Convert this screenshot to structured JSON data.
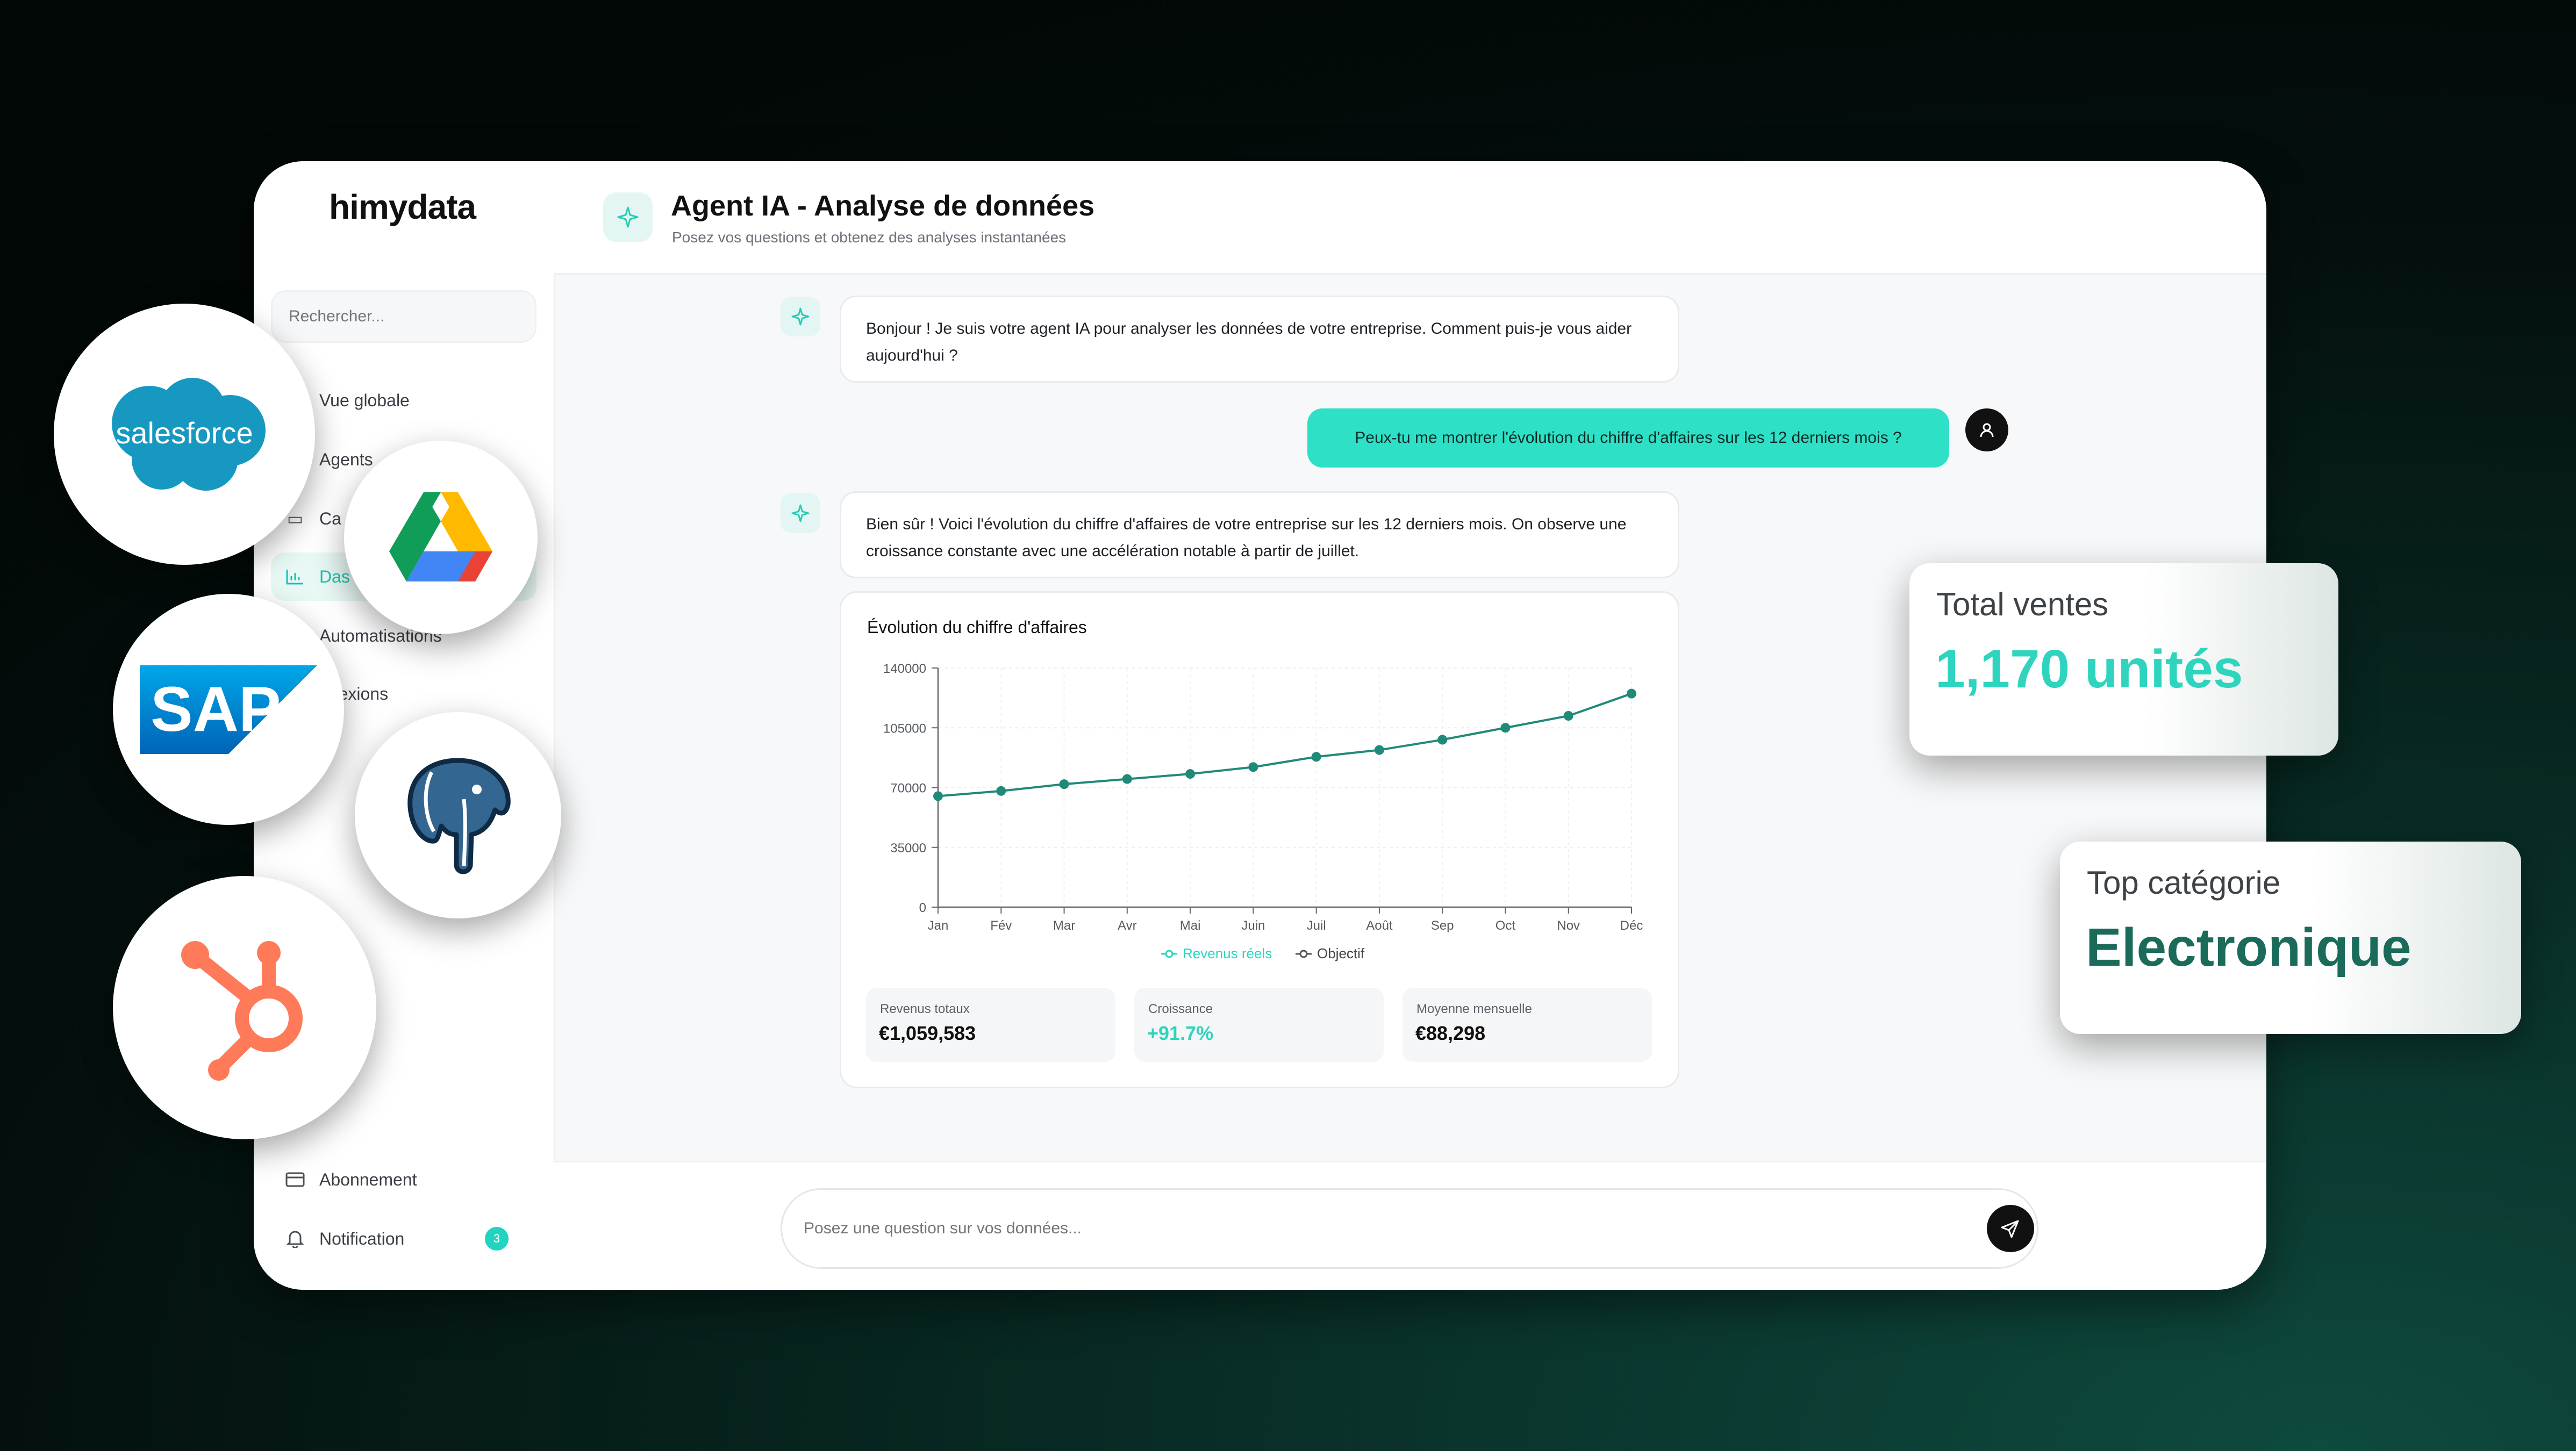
{
  "colors": {
    "accent": "#2ee0c5",
    "accent_text": "#17c3b0",
    "dark_green": "#1b6b5a"
  },
  "sidebar": {
    "logo": "himydata",
    "search_placeholder": "Rechercher...",
    "items": [
      {
        "label": "Vue globale",
        "icon": "grid-icon"
      },
      {
        "label": "Agents",
        "icon": "bot-icon"
      },
      {
        "label": "Ca",
        "icon": "folder-icon"
      },
      {
        "label": "Das",
        "icon": "bar-chart-icon",
        "active": true
      },
      {
        "label": "Automatisations",
        "icon": "zap-icon"
      },
      {
        "label": "nnexions",
        "icon": "link-icon"
      }
    ],
    "bottom": [
      {
        "label": "Abonnement",
        "icon": "card-icon"
      },
      {
        "label": "Notification",
        "icon": "bell-icon",
        "badge": "3"
      }
    ]
  },
  "header": {
    "title": "Agent IA - Analyse de données",
    "subtitle": "Posez vos questions et obtenez des analyses instantanées"
  },
  "chat": {
    "ai_msg_1": "Bonjour ! Je suis votre agent IA pour analyser les données de votre entreprise. Comment puis-je vous aider aujourd'hui ?",
    "user_msg": "Peux-tu me montrer l'évolution du chiffre d'affaires sur les 12 derniers mois ?",
    "ai_msg_2": "Bien sûr ! Voici l'évolution du chiffre d'affaires de votre entreprise sur les 12 derniers mois. On observe une croissance constante avec une accélération notable à partir de juillet."
  },
  "chart_data": {
    "type": "line",
    "title": "Évolution du chiffre d'affaires",
    "categories": [
      "Jan",
      "Fév",
      "Mar",
      "Avr",
      "Mai",
      "Juin",
      "Juil",
      "Août",
      "Sep",
      "Oct",
      "Nov",
      "Déc"
    ],
    "series": [
      {
        "name": "Revenus réels",
        "values": [
          65000,
          68000,
          72000,
          75000,
          78000,
          82000,
          88000,
          92000,
          98000,
          105000,
          112000,
          125000
        ]
      },
      {
        "name": "Objectif",
        "values": []
      }
    ],
    "ylim": [
      0,
      140000
    ],
    "yticks": [
      "0",
      "35000",
      "70000",
      "105000",
      "140000"
    ],
    "grid": true,
    "legend": "bottom"
  },
  "stats": [
    {
      "label": "Revenus totaux",
      "value": "€1,059,583"
    },
    {
      "label": "Croissance",
      "value": "+91.7%"
    },
    {
      "label": "Moyenne mensuelle",
      "value": "€88,298"
    }
  ],
  "input": {
    "placeholder": "Posez une question sur vos données..."
  },
  "cards": {
    "sales_label": "Total ventes",
    "sales_value": "1,170 unités",
    "category_label": "Top catégorie",
    "category_value": "Electronique"
  },
  "integrations": {
    "salesforce": "salesforce",
    "sap": "SAP",
    "icons": [
      "salesforce-logo-icon",
      "google-drive-icon",
      "sap-logo-icon",
      "postgresql-icon",
      "hubspot-icon"
    ]
  }
}
